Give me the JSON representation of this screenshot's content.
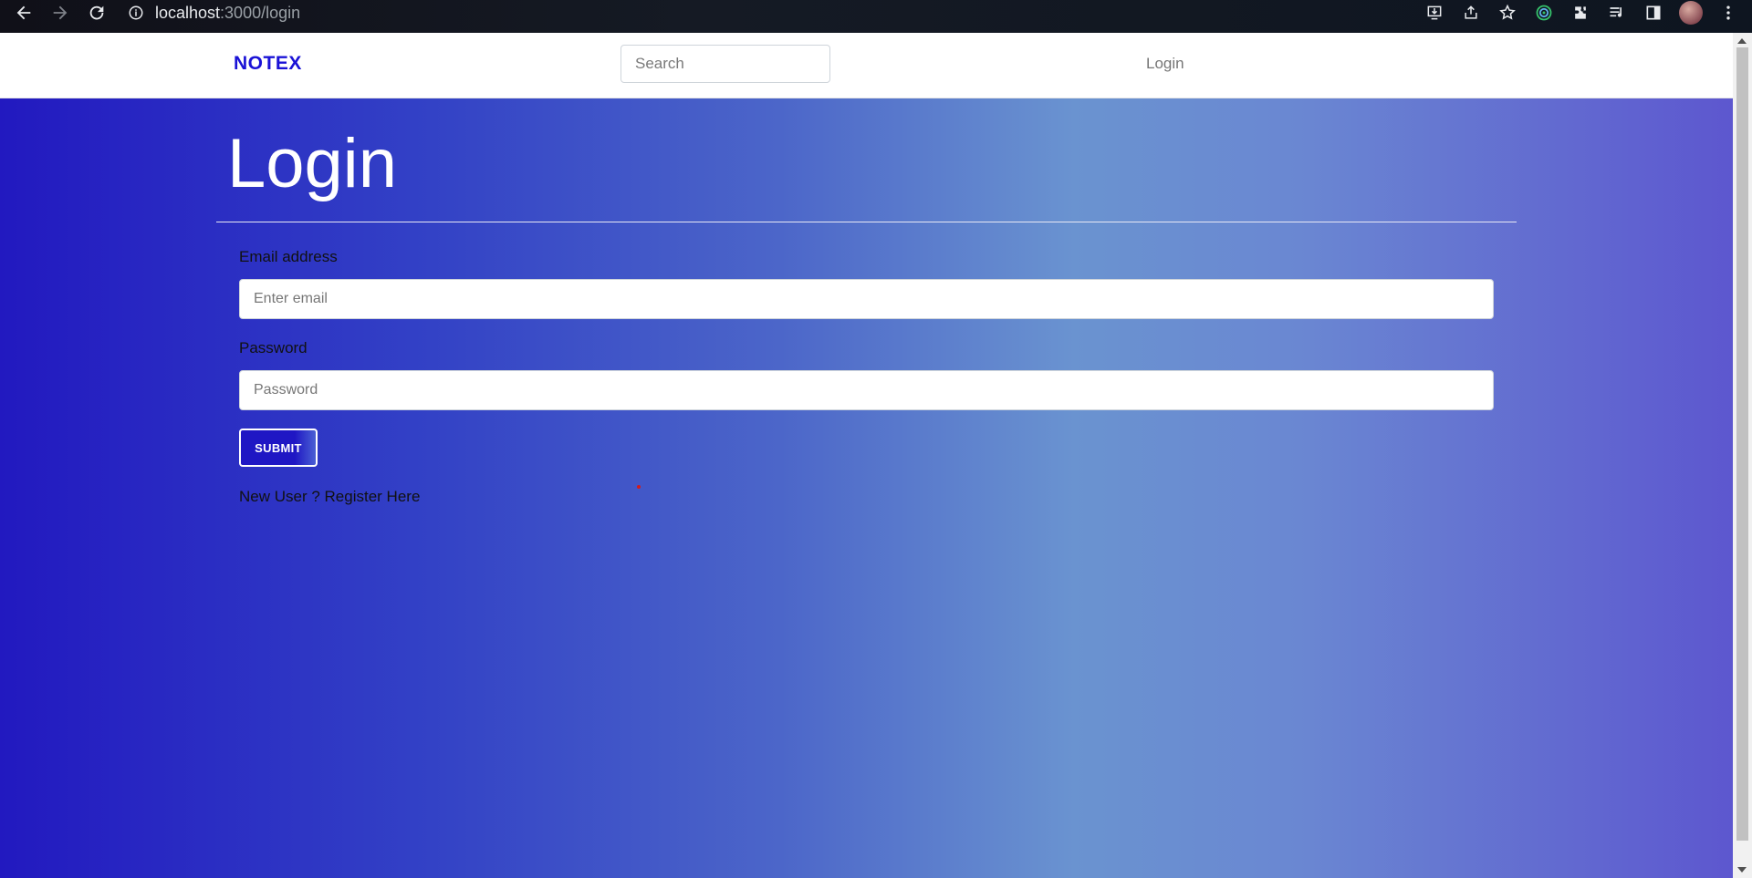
{
  "browser": {
    "url_host": "localhost",
    "url_path": ":3000/login"
  },
  "navbar": {
    "brand": "NOTEX",
    "search_placeholder": "Search",
    "login_link": "Login"
  },
  "main": {
    "heading": "Login",
    "email_label": "Email address",
    "email_placeholder": "Enter email",
    "password_label": "Password",
    "password_placeholder": "Password",
    "submit_label": "SUBMIT",
    "register_text": "New User ? Register Here"
  },
  "colors": {
    "brand": "#1a12d6",
    "gradient_start": "#2219c0",
    "gradient_mid": "#6a93d0",
    "gradient_end": "#5d57cf"
  }
}
